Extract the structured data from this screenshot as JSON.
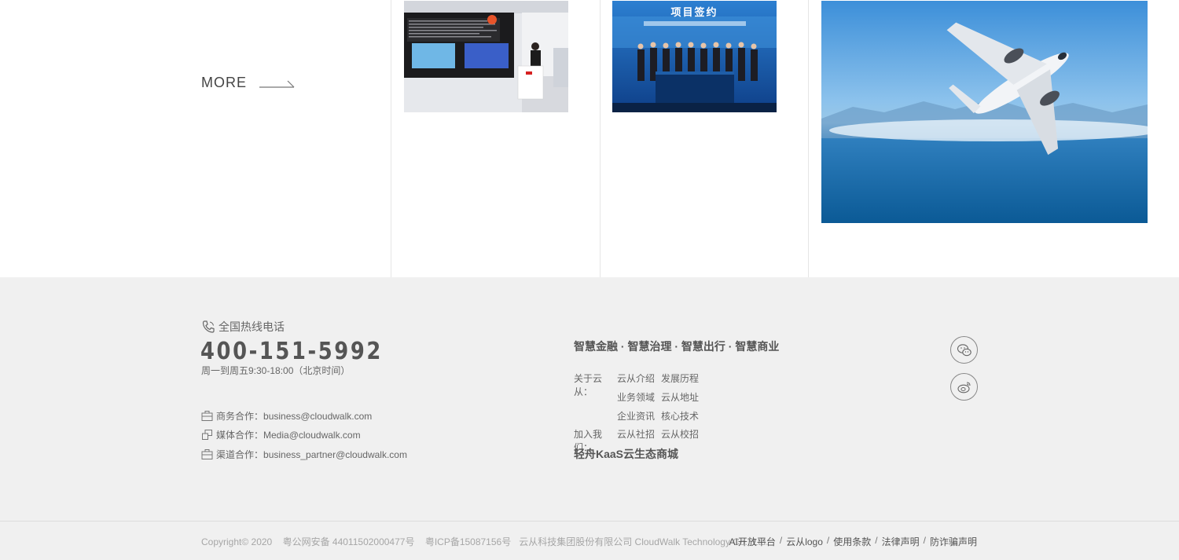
{
  "news": {
    "more_label": "MORE",
    "sign_banner_title": "项目签约"
  },
  "footer": {
    "hotline_title": "全国热线电话",
    "phone": "400-151-5992",
    "hours": "周一到周五9:30-18:00（北京时间）",
    "contacts": [
      {
        "label": "商务合作：",
        "value": "business@cloudwalk.com"
      },
      {
        "label": "媒体合作：",
        "value": "Media@cloudwalk.com"
      },
      {
        "label": "渠道合作：",
        "value": "business_partner@cloudwalk.com"
      }
    ],
    "slogan": "智慧金融 · 智慧治理 · 智慧出行 · 智慧商业",
    "links": {
      "about_label": "关于云从：",
      "about_items": [
        "云从介绍",
        "发展历程"
      ],
      "row2_items": [
        "业务领域",
        "云从地址"
      ],
      "row3_items": [
        "企业资讯",
        "核心技术"
      ],
      "join_label": "加入我们：",
      "join_items": [
        "云从社招",
        "云从校招"
      ]
    },
    "kaas": "轻舟KaaS云生态商城",
    "copyright": {
      "c1": "Copyright© 2020",
      "c2": "粤公网安备 44011502000477号",
      "c3": "粤ICP备15087156号",
      "c4": "云从科技集团股份有限公司 CloudWalk Technology Co., Ltd."
    },
    "legal": [
      "AI开放平台",
      "云从logo",
      "使用条款",
      "法律声明",
      "防诈骗声明"
    ],
    "legal_sep": "/"
  },
  "colors": {
    "footer_bg": "#f0f0f0",
    "text": "#555555",
    "muted": "#a6a6a6"
  }
}
